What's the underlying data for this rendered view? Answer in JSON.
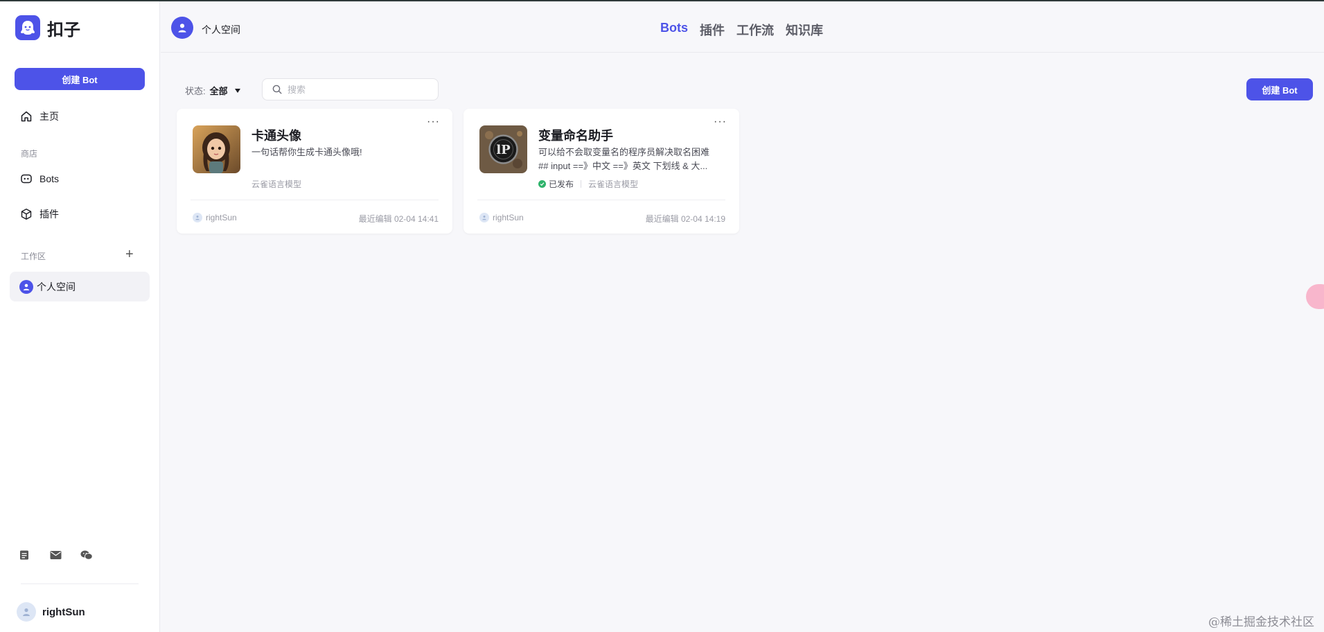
{
  "app": {
    "name": "扣子",
    "brand_color": "#4d53e8"
  },
  "sidebar": {
    "create_button": "创建 Bot",
    "home": "主页",
    "store_label": "商店",
    "store_items": [
      {
        "label": "Bots",
        "icon": "bot-icon"
      },
      {
        "label": "插件",
        "icon": "cube-icon"
      }
    ],
    "workspace_label": "工作区",
    "workspace_add": "+",
    "workspace_item": "个人空间",
    "footer_icons": [
      "document-icon",
      "mail-icon",
      "wechat-icon"
    ],
    "user_name": "rightSun"
  },
  "header": {
    "space_name": "个人空间",
    "tabs": [
      {
        "label": "Bots",
        "active": true
      },
      {
        "label": "插件",
        "active": false
      },
      {
        "label": "工作流",
        "active": false
      },
      {
        "label": "知识库",
        "active": false
      }
    ]
  },
  "toolbar": {
    "status_label": "状态:",
    "status_value": "全部",
    "search_placeholder": "搜索",
    "search_value": "",
    "create_button": "创建 Bot"
  },
  "cards": [
    {
      "title": "卡通头像",
      "desc_lines": [
        "一句话帮你生成卡通头像哦!"
      ],
      "published": "",
      "model": "云雀语言模型",
      "author": "rightSun",
      "edited": "最近编辑 02-04 14:41",
      "more": "···"
    },
    {
      "title": "变量命名助手",
      "desc_lines": [
        "可以给不会取变量名的程序员解决取名困难",
        "## input ==》中文 ==》英文 下划线 & 大..."
      ],
      "published": "已发布",
      "model": "云雀语言模型",
      "author": "rightSun",
      "edited": "最近编辑 02-04 14:19",
      "more": "···"
    }
  ],
  "watermark": "@稀土掘金技术社区"
}
